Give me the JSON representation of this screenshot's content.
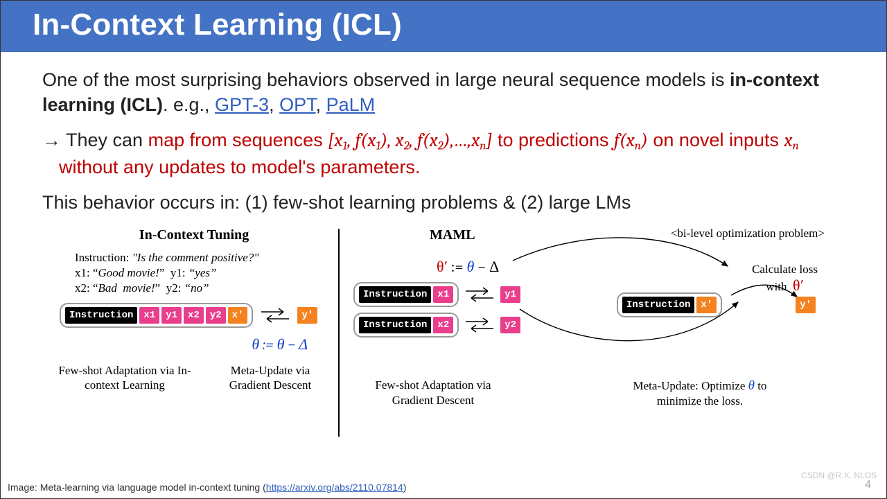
{
  "title": "In-Context Learning (ICL)",
  "para1_pre": "One of the most surprising behaviors observed in large neural sequence models is ",
  "para1_bold": "in-context learning (ICL)",
  "para1_mid": ". e.g., ",
  "links": {
    "gpt3": "GPT-3",
    "opt": "OPT",
    "palm": "PaLM"
  },
  "para2_arrow": "→ ",
  "para2_a": "They can ",
  "para2_b": "map from sequences ",
  "seq_open": "[",
  "seq_x1": "x",
  "seq_sub1": "1",
  "seq_comma": ", ",
  "seq_f": "f",
  "seq_xn": "x",
  "seq_subn": "n",
  "seq_close": "]",
  "para2_c": " to predictions ",
  "para2_d": " on novel inputs ",
  "para2_e": " without any updates to model's parameters.",
  "para3": "This behavior occurs in: (1) few-shot learning problems & (2) large LMs",
  "fig": {
    "left_title": "In-Context Tuning",
    "inst_label": "Instruction: ",
    "inst_q": "\"Is the comment positive?\"",
    "ex1": "x1: \"Good movie!\"  y1: \"yes\"",
    "ex2": "x2: \"Bad  movie!\"  y2: \"no\"",
    "tok_instr": "Instruction",
    "tok_x1": "x1",
    "tok_y1": "y1",
    "tok_x2": "x2",
    "tok_y2": "y2",
    "tok_xp": "x'",
    "tok_yp": "y'",
    "theta_update": "θ := θ − Δ",
    "theta_prime_update": "θ′ := θ − Δ",
    "capL1": "Few-shot Adaptation via In-context Learning",
    "capL2": "Meta-Update via Gradient Descent",
    "right_title": "MAML",
    "biopt": "<bi-level optimization problem>",
    "calc1": "Calculate loss",
    "calc2": "with  θ′",
    "capR1": "Few-shot Adaptation via Gradient Descent",
    "capR2_a": "Meta-Update: Optimize ",
    "capR2_b": "θ",
    "capR2_c": " to minimize the loss."
  },
  "footer_pre": "Image: Meta-learning via language model in-context tuning (",
  "footer_url": "https://arxiv.org/abs/2110.07814",
  "footer_post": ")",
  "watermark": "CSDN @R.X. NLOS",
  "page": "4"
}
